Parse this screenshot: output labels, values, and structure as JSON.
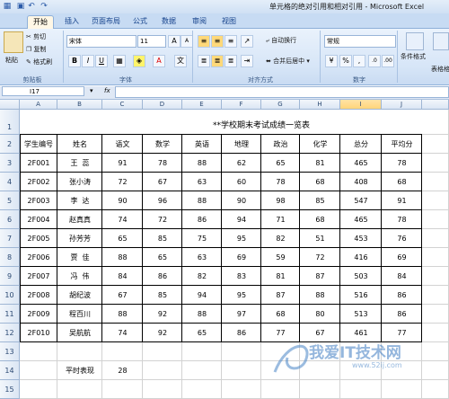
{
  "window": {
    "title": "单元格的绝对引用和相对引用 - Microsoft Excel"
  },
  "tabs": [
    "开始",
    "插入",
    "页面布局",
    "公式",
    "数据",
    "审阅",
    "视图"
  ],
  "ribbon": {
    "clipboard": {
      "paste": "粘贴",
      "cut": "剪切",
      "copy": "复制",
      "format_painter": "格式刷",
      "label": "剪贴板"
    },
    "font": {
      "name": "宋体",
      "size": "11",
      "label": "字体",
      "bold": "B",
      "italic": "I",
      "underline": "U"
    },
    "alignment": {
      "wrap": "自动换行",
      "merge": "合并后居中",
      "label": "对齐方式"
    },
    "number": {
      "format": "常规",
      "label": "数字",
      "percent": "%",
      "comma": ","
    },
    "styles": {
      "conditional": "条件格式",
      "table": "表格格"
    }
  },
  "formula_bar": {
    "name_box": "I17",
    "fx": "fx",
    "value": ""
  },
  "columns": [
    "A",
    "B",
    "C",
    "D",
    "E",
    "F",
    "G",
    "H",
    "I",
    "J"
  ],
  "selected_column": "I",
  "rows": [
    "1",
    "2",
    "3",
    "4",
    "5",
    "6",
    "7",
    "8",
    "9",
    "10",
    "11",
    "12",
    "13",
    "14",
    "15"
  ],
  "sheet": {
    "title": "**学校期末考试成绩一览表",
    "headers": [
      "学生编号",
      "姓名",
      "语文",
      "数学",
      "英语",
      "地理",
      "政治",
      "化学",
      "总分",
      "平均分"
    ],
    "records": [
      [
        "2F001",
        "王  蕊",
        "91",
        "78",
        "88",
        "62",
        "65",
        "81",
        "465",
        "78"
      ],
      [
        "2F002",
        "张小涛",
        "72",
        "67",
        "63",
        "60",
        "78",
        "68",
        "408",
        "68"
      ],
      [
        "2F003",
        "李  达",
        "90",
        "96",
        "88",
        "90",
        "98",
        "85",
        "547",
        "91"
      ],
      [
        "2F004",
        "赵真真",
        "74",
        "72",
        "86",
        "94",
        "71",
        "68",
        "465",
        "78"
      ],
      [
        "2F005",
        "孙芳芳",
        "65",
        "85",
        "75",
        "95",
        "82",
        "51",
        "453",
        "76"
      ],
      [
        "2F006",
        "贾  佳",
        "88",
        "65",
        "63",
        "69",
        "59",
        "72",
        "416",
        "69"
      ],
      [
        "2F007",
        "冯  伟",
        "84",
        "86",
        "82",
        "83",
        "81",
        "87",
        "503",
        "84"
      ],
      [
        "2F008",
        "胡纪波",
        "67",
        "85",
        "94",
        "95",
        "87",
        "88",
        "516",
        "86"
      ],
      [
        "2F009",
        "程百川",
        "88",
        "92",
        "88",
        "97",
        "68",
        "80",
        "513",
        "86"
      ],
      [
        "2F010",
        "吴航航",
        "74",
        "92",
        "65",
        "86",
        "77",
        "67",
        "461",
        "77"
      ]
    ],
    "extra_label": "平时表现",
    "extra_value": "28"
  },
  "watermark": {
    "text": "我爱IT技术网",
    "url": "www.52ij.com"
  }
}
